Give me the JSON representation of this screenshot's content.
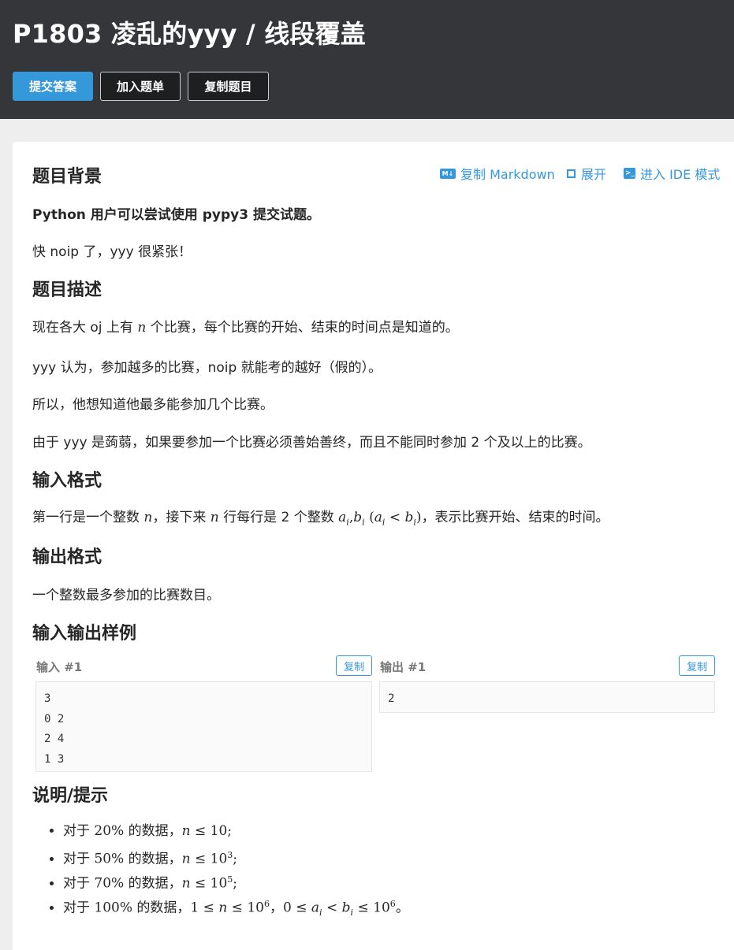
{
  "header": {
    "title": "P1803 凌乱的yyy / 线段覆盖",
    "buttons": {
      "submit": "提交答案",
      "add_list": "加入题单",
      "copy_problem": "复制题目"
    }
  },
  "toolbar": {
    "copy_markdown": "复制 Markdown",
    "expand": "展开",
    "ide_mode": "进入 IDE 模式"
  },
  "background": {
    "heading": "题目背景",
    "line1": "Python 用户可以尝试使用 pypy3 提交试题。",
    "line2": "快 noip 了，yyy 很紧张！"
  },
  "description": {
    "heading": "题目描述",
    "p1_pre": "现在各大 oj 上有 ",
    "p1_var": "n",
    "p1_post": " 个比赛，每个比赛的开始、结束的时间点是知道的。",
    "p2": "yyy 认为，参加越多的比赛，noip 就能考的越好（假的）。",
    "p3": "所以，他想知道他最多能参加几个比赛。",
    "p4": "由于 yyy 是蒟蒻，如果要参加一个比赛必须善始善终，而且不能同时参加 2 个及以上的比赛。"
  },
  "input_format": {
    "heading": "输入格式",
    "t1": "第一行是一个整数 ",
    "v_n": "n",
    "t2": "，接下来 ",
    "t3": " 行每行是 2 个整数 ",
    "a": "a",
    "i": "i",
    "comma": ",",
    "b": "b",
    "cond_open": "(",
    "lt": " < ",
    "cond_close": ")",
    "t4": "，表示比赛开始、结束的时间。"
  },
  "output_format": {
    "heading": "输出格式",
    "text": "一个整数最多参加的比赛数目。"
  },
  "samples": {
    "heading": "输入输出样例",
    "input_label": "输入 #1",
    "output_label": "输出 #1",
    "copy_label": "复制",
    "input_text": "3\n0 2\n2 4\n1 3",
    "output_text": "2"
  },
  "hints": {
    "heading": "说明/提示",
    "items": [
      {
        "pre": "对于 ",
        "pct": "20%",
        "mid": " 的数据，",
        "n": "n",
        "le": " ≤ ",
        "bound": "10",
        "exp": "",
        "end": ";"
      },
      {
        "pre": "对于 ",
        "pct": "50%",
        "mid": " 的数据，",
        "n": "n",
        "le": " ≤ ",
        "bound": "10",
        "exp": "3",
        "end": ";"
      },
      {
        "pre": "对于 ",
        "pct": "70%",
        "mid": " 的数据，",
        "n": "n",
        "le": " ≤ ",
        "bound": "10",
        "exp": "5",
        "end": ";"
      },
      {
        "pre": "对于 ",
        "pct": "100%",
        "mid": " 的数据，",
        "one": "1",
        "le": " ≤ ",
        "n": "n",
        "bound": "10",
        "exp": "6",
        "sep": "，",
        "zero": "0",
        "a": "a",
        "i": "i",
        "lt": " < ",
        "b": "b",
        "exp2": "6",
        "end": "。"
      }
    ]
  }
}
